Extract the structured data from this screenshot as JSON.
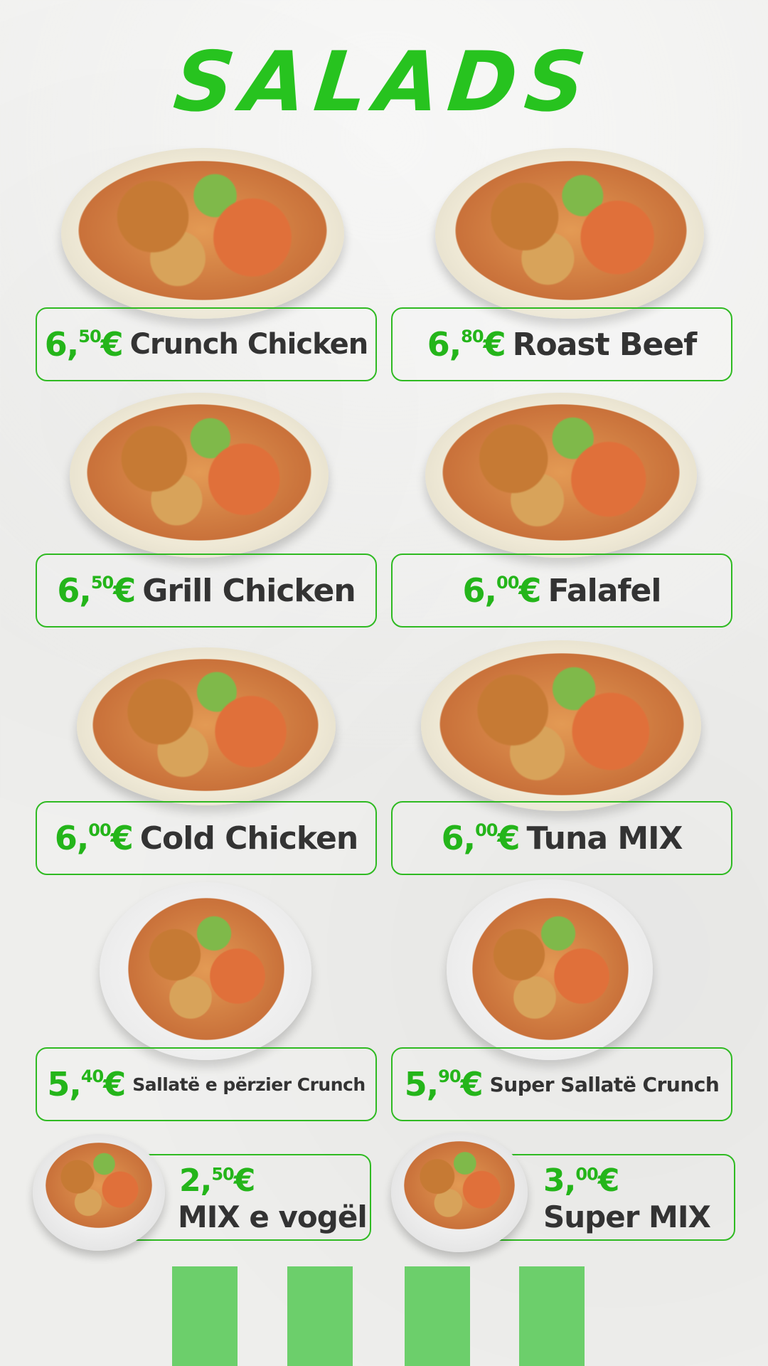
{
  "title": "SALADS",
  "items": [
    {
      "price_int": "6,",
      "price_dec": "50",
      "currency": "€",
      "name": "Crunch Chicken"
    },
    {
      "price_int": "6,",
      "price_dec": "80",
      "currency": "€",
      "name": "Roast Beef"
    },
    {
      "price_int": "6,",
      "price_dec": "50",
      "currency": "€",
      "name": "Grill Chicken"
    },
    {
      "price_int": "6,",
      "price_dec": "00",
      "currency": "€",
      "name": "Falafel"
    },
    {
      "price_int": "6,",
      "price_dec": "00",
      "currency": "€",
      "name": "Cold Chicken"
    },
    {
      "price_int": "6,",
      "price_dec": "00",
      "currency": "€",
      "name": "Tuna MIX"
    },
    {
      "price_int": "5,",
      "price_dec": "40",
      "currency": "€",
      "name": "Sallatë e përzier Crunch"
    },
    {
      "price_int": "5,",
      "price_dec": "90",
      "currency": "€",
      "name": "Super Sallatë Crunch"
    }
  ],
  "small_items": [
    {
      "price_int": "2,",
      "price_dec": "50",
      "currency": "€",
      "name": "MIX e vogël"
    },
    {
      "price_int": "3,",
      "price_dec": "00",
      "currency": "€",
      "name": "Super MIX"
    }
  ],
  "colors": {
    "accent": "#27c31f",
    "text": "#333333",
    "stripe": "#6ccf6b"
  }
}
